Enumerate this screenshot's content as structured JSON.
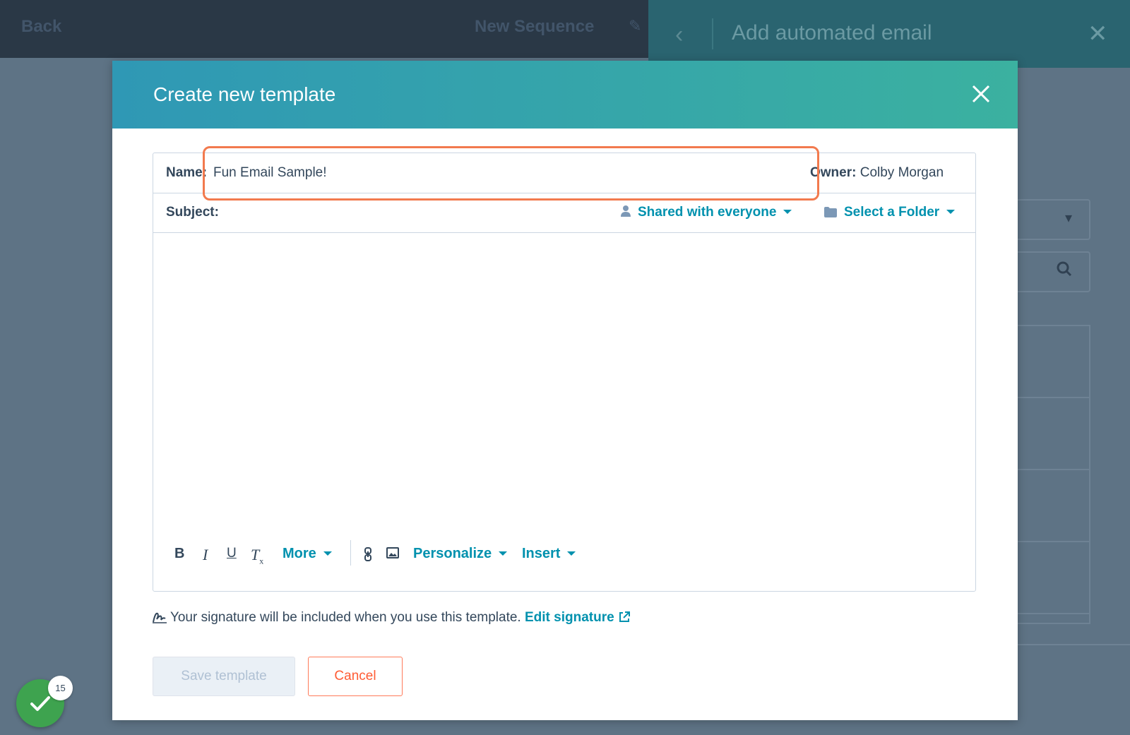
{
  "background": {
    "back_label": "Back",
    "sequence_title": "New Sequence",
    "panel_title": "Add automated email"
  },
  "modal": {
    "title": "Create new template",
    "name_label": "Name:",
    "name_value": "Fun Email Sample!",
    "owner_label": "Owner:",
    "owner_value": "Colby Morgan",
    "subject_label": "Subject:",
    "subject_value": "",
    "sharing": "Shared with everyone",
    "folder": "Select a Folder",
    "toolbar": {
      "bold": "B",
      "italic": "I",
      "underline": "U",
      "clear_format": "T",
      "clear_format_sub": "x",
      "more": "More",
      "personalize": "Personalize",
      "insert": "Insert"
    },
    "signature_text": "Your signature will be included when you use this template.",
    "edit_signature": "Edit signature",
    "save_button": "Save template",
    "cancel_button": "Cancel"
  },
  "notification_count": "15",
  "colors": {
    "header_start": "#2f98b5",
    "header_end": "#3bb1a0",
    "link": "#0091ae",
    "highlight": "#f27a4e",
    "cancel": "#ff5c35",
    "fab": "#3ea34f"
  },
  "icons": [
    "close-icon",
    "user-icon",
    "folder-icon",
    "link-icon",
    "image-icon",
    "signature-icon",
    "external-link-icon",
    "checkmark-icon",
    "chevron-left-icon",
    "search-icon",
    "pencil-icon"
  ]
}
